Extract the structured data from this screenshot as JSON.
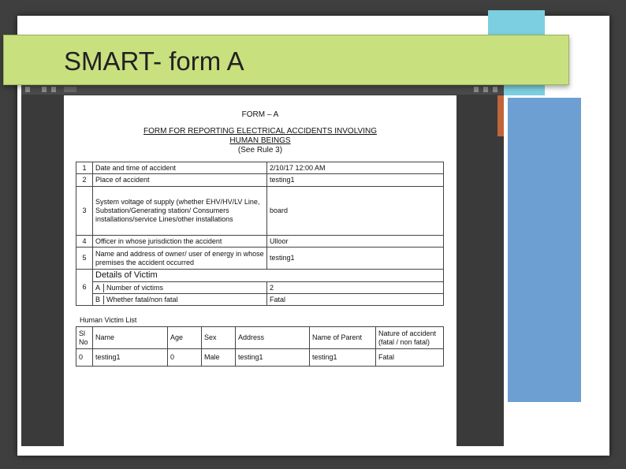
{
  "slide": {
    "title": "SMART- form A"
  },
  "form": {
    "title": "FORM – A",
    "heading_line1": "FORM FOR REPORTING ELECTRICAL ACCIDENTS INVOLVING",
    "heading_line2": "HUMAN BEINGS",
    "rule": "(See Rule 3)",
    "rows": [
      {
        "num": "1",
        "label": "Date and time of accident",
        "value": "2/10/17 12:00 AM"
      },
      {
        "num": "2",
        "label": "Place of accident",
        "value": "testing1"
      },
      {
        "num": "3",
        "label": "System voltage of supply (whether EHV/HV/LV Line, Substation/Generating station/ Consumers installations/service Lines/other installations",
        "value": "board"
      },
      {
        "num": "4",
        "label": "Officer in whose jurisdiction the accident",
        "value": "Ulloor"
      },
      {
        "num": "5",
        "label": "Name and address of owner/ user of energy in whose premises the accident occurred",
        "value": "testing1"
      }
    ],
    "victim_details": {
      "heading": "Details of Victim",
      "num": "6",
      "a_letter": "A",
      "a_label": "Number of victims",
      "a_value": "2",
      "b_letter": "B",
      "b_label": "Whether fatal/non fatal",
      "b_value": "Fatal"
    }
  },
  "victim_list": {
    "heading": "Human Victim List",
    "columns": [
      "Sl No",
      "Name",
      "Age",
      "Sex",
      "Address",
      "Name of Parent",
      "Nature of accident (fatal / non fatal)"
    ],
    "rows": [
      [
        "0",
        "testing1",
        "0",
        "Male",
        "testing1",
        "testing1",
        "Fatal"
      ]
    ]
  }
}
